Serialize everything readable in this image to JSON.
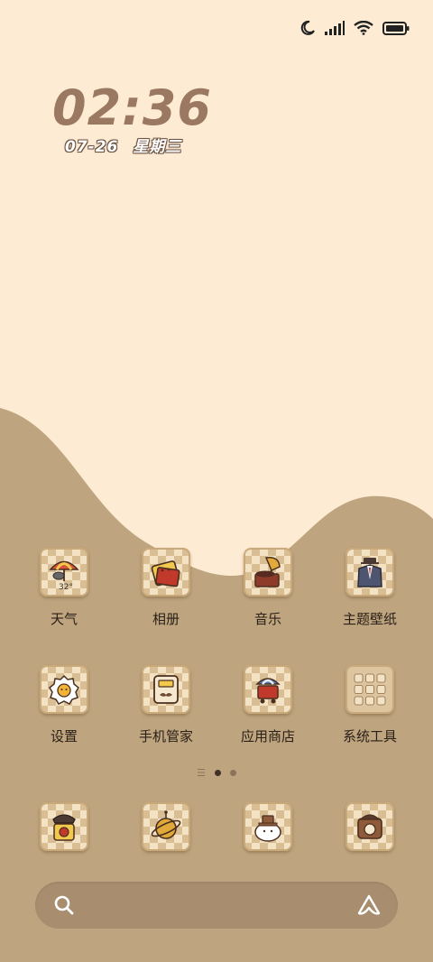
{
  "status_bar": {
    "icons": [
      "moon-icon",
      "signal-icon",
      "wifi-icon",
      "battery-icon"
    ]
  },
  "clock": {
    "time": "02:36",
    "date": "07-26",
    "weekday": "星期三"
  },
  "apps_row1": [
    {
      "label": "天气",
      "icon": "weather-umbrella-icon",
      "badge": "32°"
    },
    {
      "label": "相册",
      "icon": "gallery-icon"
    },
    {
      "label": "音乐",
      "icon": "gramophone-icon"
    },
    {
      "label": "主题壁纸",
      "icon": "suit-icon"
    }
  ],
  "apps_row2": [
    {
      "label": "设置",
      "icon": "settings-egg-icon"
    },
    {
      "label": "手机管家",
      "icon": "phone-manager-icon"
    },
    {
      "label": "应用商店",
      "icon": "store-cart-icon"
    },
    {
      "label": "系统工具",
      "icon": "system-tools-folder-icon"
    }
  ],
  "dock": [
    {
      "icon": "phone-icon"
    },
    {
      "icon": "browser-planet-icon"
    },
    {
      "icon": "messages-icon"
    },
    {
      "icon": "camera-icon"
    }
  ],
  "colors": {
    "background": "#fdebd3",
    "wave": "#bea57f",
    "clock": "#9b7861",
    "search_bar": "#a88e6f"
  }
}
